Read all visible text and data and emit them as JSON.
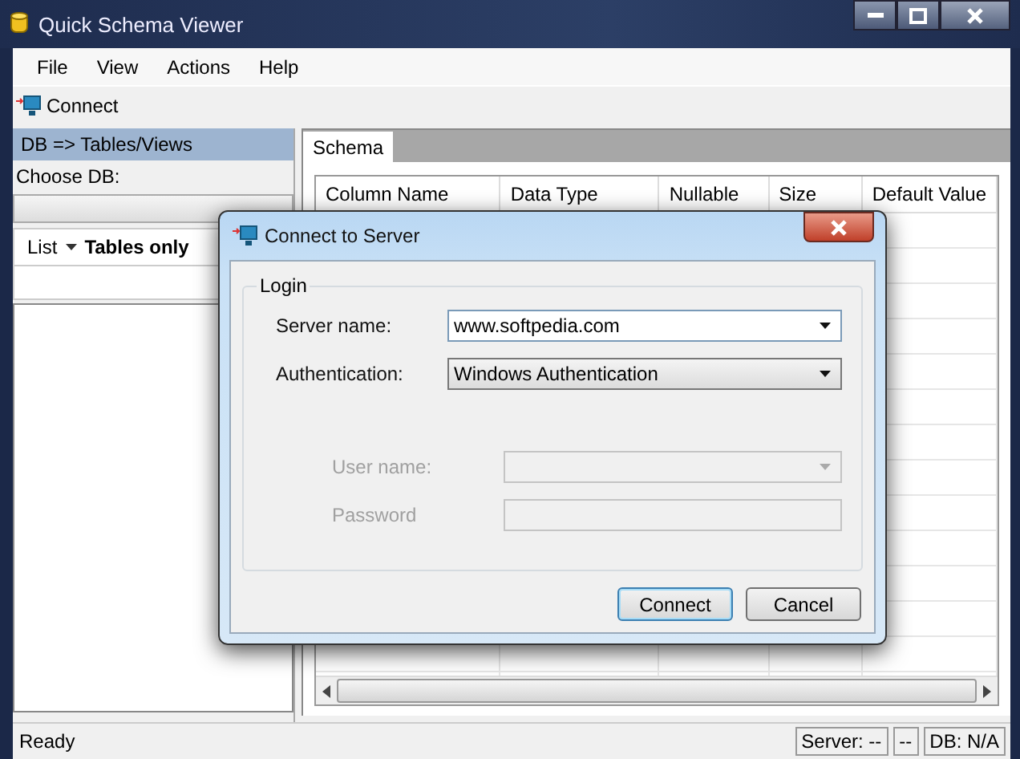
{
  "window": {
    "title": "Quick Schema Viewer"
  },
  "menu": [
    "File",
    "View",
    "Actions",
    "Help"
  ],
  "toolbar": [
    {
      "label": "Connect"
    }
  ],
  "left_panel": {
    "header": "DB => Tables/Views",
    "choose_db_label": "Choose DB:",
    "list_menu": "List",
    "filter": "Tables only"
  },
  "tabs": [
    {
      "label": "Schema",
      "selected": true
    }
  ],
  "grid": {
    "columns": [
      "Column Name",
      "Data Type",
      "Nullable",
      "Size",
      "Default Value"
    ]
  },
  "status_bar": {
    "message": "Ready",
    "server": "Server: --",
    "middle": "--",
    "db": "DB: N/A"
  },
  "dialog": {
    "title": "Connect to Server",
    "group": "Login",
    "fields": [
      {
        "label": "Server name:",
        "value": "www.softpedia.com",
        "kind": "combo",
        "disabled": false
      },
      {
        "label": "Authentication:",
        "value": "Windows Authentication",
        "kind": "dropdown",
        "disabled": false
      },
      {
        "label": "User name:",
        "kind": "combo",
        "disabled": true
      },
      {
        "label": "Password",
        "kind": "text",
        "disabled": true
      }
    ],
    "buttons": [
      {
        "label": "Connect",
        "default": true
      },
      {
        "label": "Cancel",
        "default": false
      }
    ]
  }
}
